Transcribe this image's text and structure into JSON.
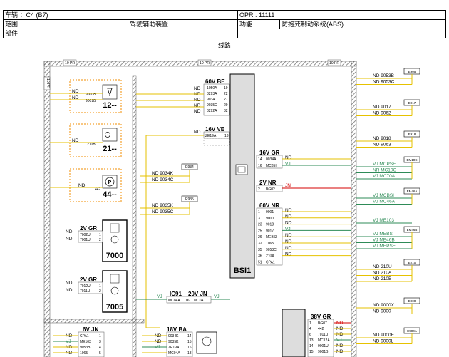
{
  "header": {
    "vehicle": "车辆 ：C4 (B7)",
    "opr": "OPR : 11111",
    "scope_label": "范围",
    "scope_value": "驾驶辅助装置",
    "function_label": "功能",
    "function_value": "防抱死制动系统(ABS)",
    "part_label": "部件"
  },
  "diagram_title": "线路",
  "frame": {
    "pr_left": "10 PR",
    "pr_mid": "10 PR",
    "pr_right": "10 PR",
    "pr_side": "10 PR"
  },
  "modules": {
    "m12": {
      "code": "12--",
      "pins": [
        {
          "sig": "ND",
          "wire": "9000B",
          "pin": "1"
        },
        {
          "sig": "ND",
          "wire": "9001B",
          "pin": "2"
        }
      ]
    },
    "m21": {
      "code": "21--",
      "pins": [
        {
          "sig": "ND",
          "wire": "210B",
          "pin": "1"
        }
      ]
    },
    "m44": {
      "code": "44--",
      "pins": [
        {
          "sig": "ND",
          "wire": "442",
          "pin": "1"
        }
      ]
    },
    "m7000": {
      "code": "7000",
      "conn": "2V GR",
      "pins": [
        {
          "sig": "ND",
          "wire": "7002U",
          "pin": "1"
        },
        {
          "sig": "ND",
          "wire": "7001U",
          "pin": "2"
        }
      ]
    },
    "m7005": {
      "code": "7005",
      "conn": "2V GR",
      "pins": [
        {
          "sig": "ND",
          "wire": "7012U",
          "pin": "1"
        },
        {
          "sig": "ND",
          "wire": "7011U",
          "pin": "2"
        }
      ]
    }
  },
  "bsi": {
    "name": "BSI1",
    "c60v": {
      "name": "60V BE",
      "rows": [
        {
          "sig": "ND",
          "wire": "1050A",
          "pin": "19"
        },
        {
          "sig": "ND",
          "wire": "8293A",
          "pin": "22"
        },
        {
          "sig": "ND",
          "wire": "9034C",
          "pin": "27"
        },
        {
          "sig": "ND",
          "wire": "9035C",
          "pin": "29"
        },
        {
          "sig": "ND",
          "wire": "8292A",
          "pin": "32"
        }
      ]
    },
    "c16ve": {
      "name": "16V VE",
      "rows": [
        {
          "sig": "ND",
          "wire": "ZE19A",
          "pin": "13"
        }
      ]
    },
    "c16gr": {
      "name": "16V GR",
      "rows": [
        {
          "pin": "14",
          "wire": "0034A",
          "sig": "ND"
        },
        {
          "pin": "16",
          "wire": "MC85I",
          "sig": "VJ"
        }
      ]
    },
    "c2vnr": {
      "name": "2V NR",
      "rows": [
        {
          "pin": "2",
          "wire": "BG02",
          "sig": "JN"
        }
      ]
    },
    "c60vnr": {
      "name": "60V NR",
      "rows": [
        {
          "pin": "1",
          "wire": "9001",
          "sig": "ND"
        },
        {
          "pin": "3",
          "wire": "9000",
          "sig": "ND"
        },
        {
          "pin": "23",
          "wire": "9018",
          "sig": "ND"
        },
        {
          "pin": "25",
          "wire": "9017",
          "sig": "VJ"
        },
        {
          "pin": "26",
          "wire": "MEBSI",
          "sig": "ND"
        },
        {
          "pin": "32",
          "wire": "1065",
          "sig": "ND"
        },
        {
          "pin": "35",
          "wire": "9053C",
          "sig": "ND"
        },
        {
          "pin": "36",
          "wire": "210A",
          "sig": "ND"
        },
        {
          "pin": "51",
          "wire": "CPA1",
          "sig": ""
        }
      ]
    }
  },
  "e934": {
    "name": "E934",
    "sigs": [
      "ND 9034K",
      "ND 9034C"
    ]
  },
  "e935": {
    "name": "E935",
    "sigs": [
      "ND 9035K",
      "ND 9035C"
    ]
  },
  "ic91": {
    "name": "IC91",
    "conn": "20V JN",
    "wire": "MC04A",
    "pin": "16",
    "wire2": "MC04",
    "sig_l": "VJ",
    "sig_r": "VJ"
  },
  "c6vjn": {
    "name": "6V JN",
    "rows": [
      {
        "sig": "ND",
        "wire": "CPA1",
        "pin": "1"
      },
      {
        "sig": "VJ",
        "wire": "ME103",
        "pin": "3"
      },
      {
        "sig": "ND",
        "wire": "9053B",
        "pin": "4"
      },
      {
        "sig": "ND",
        "wire": "1065",
        "pin": "5"
      }
    ]
  },
  "c18vba": {
    "name": "18V BA",
    "rows": [
      {
        "sig": "ND",
        "wire": "9034K",
        "pin": "14"
      },
      {
        "sig": "ND",
        "wire": "9035K",
        "pin": "15"
      },
      {
        "sig": "VJ",
        "wire": "ZE19A",
        "pin": "16"
      },
      {
        "sig": "",
        "wire": "MC04A",
        "pin": "18"
      }
    ]
  },
  "c38vgr": {
    "name": "38V GR",
    "rows": [
      {
        "pin": "1",
        "wire": "BG07",
        "sig": "ND"
      },
      {
        "pin": "4",
        "wire": "442",
        "sig": "ND"
      },
      {
        "pin": "6",
        "wire": "7011U",
        "sig": "ND"
      },
      {
        "pin": "13",
        "wire": "MC12A",
        "sig": "VJ"
      },
      {
        "pin": "14",
        "wire": "9001U",
        "sig": "ND"
      },
      {
        "pin": "15",
        "wire": "9001B",
        "sig": "ND"
      }
    ]
  },
  "right": [
    {
      "tag": "E905",
      "sigs": [
        "ND 9053B",
        "ND 9053C"
      ]
    },
    {
      "tag": "E917",
      "sigs": [
        "ND 9017",
        "ND 9062"
      ]
    },
    {
      "tag": "E918",
      "sigs": [
        "ND 9018",
        "ND 9063"
      ]
    },
    {
      "tag": "EM10C",
      "sigs": [
        "VJ MCPSF",
        "NR MC10C",
        "VJ MC70A"
      ]
    },
    {
      "tag": "EM46A",
      "sigs": [
        "VJ MCBSI",
        "VJ MC46A"
      ]
    },
    {
      "tag": "",
      "sigs": [
        "VJ ME103"
      ]
    },
    {
      "tag": "EM46B",
      "sigs": [
        "VJ MEBSI",
        "VJ ME46B",
        "VJ MEPSF"
      ]
    },
    {
      "tag": "E210",
      "sigs": [
        "ND 210U",
        "ND 210A",
        "ND 210B"
      ]
    },
    {
      "tag": "E900",
      "sigs": [
        "ND 9000X",
        "ND 9000"
      ]
    },
    {
      "tag": "E900A",
      "sigs": [
        "ND 9000E",
        "ND 9000L"
      ]
    }
  ],
  "colors": {
    "yellow": "#e6c200",
    "orange": "#f08c00",
    "green": "#2e8b57",
    "red": "#d40000",
    "grey": "#888888",
    "hatch": "#777777"
  }
}
